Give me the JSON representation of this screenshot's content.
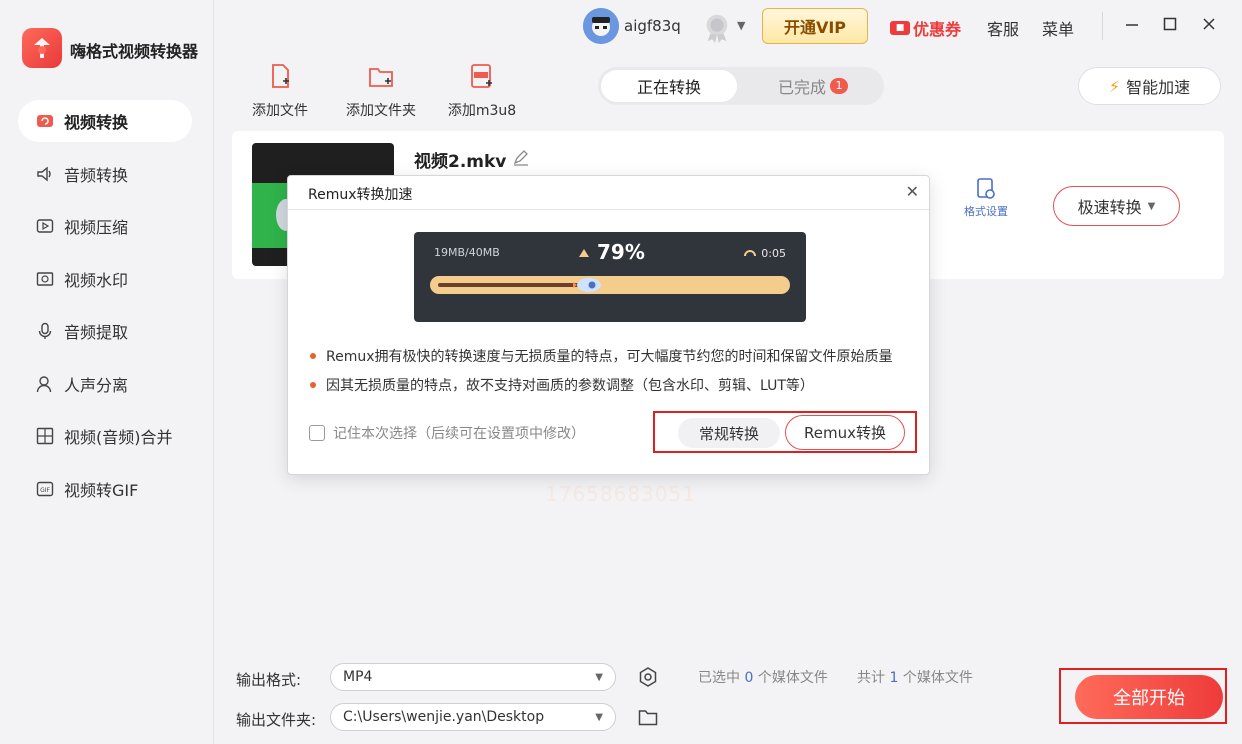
{
  "app": {
    "title": "嗨格式视频转换器"
  },
  "sidebar": {
    "items": [
      {
        "label": "视频转换",
        "icon": "video-convert-icon",
        "active": true
      },
      {
        "label": "音频转换",
        "icon": "audio-convert-icon"
      },
      {
        "label": "视频压缩",
        "icon": "video-compress-icon"
      },
      {
        "label": "视频水印",
        "icon": "video-watermark-icon"
      },
      {
        "label": "音频提取",
        "icon": "audio-extract-icon"
      },
      {
        "label": "人声分离",
        "icon": "voice-separate-icon"
      },
      {
        "label": "视频(音频)合并",
        "icon": "merge-icon"
      },
      {
        "label": "视频转GIF",
        "icon": "gif-icon"
      }
    ]
  },
  "topbar": {
    "username": "aigf83q",
    "vip_label": "开通VIP",
    "coupon_label": "优惠券",
    "service_label": "客服",
    "menu_label": "菜单"
  },
  "toolbar": {
    "add_file": "添加文件",
    "add_folder": "添加文件夹",
    "add_m3u8": "添加m3u8"
  },
  "tabs": {
    "converting": "正在转换",
    "done": "已完成",
    "done_count": "1"
  },
  "accel_label": "智能加速",
  "file": {
    "name": "视频2.mkv",
    "format_setting": "格式设置",
    "convert_mode": "极速转换"
  },
  "dialog": {
    "title": "Remux转换加速",
    "demo_size": "19MB/40MB",
    "demo_percent": "79%",
    "demo_progress": 0.42,
    "demo_time": "0:05",
    "bullets": [
      "Remux拥有极快的转换速度与无损质量的特点，可大幅度节约您的时间和保留文件原始质量",
      "因其无损质量的特点，故不支持对画质的参数调整（包含水印、剪辑、LUT等）"
    ],
    "remember_label": "记住本次选择（后续可在设置项中修改）",
    "normal_btn": "常规转换",
    "remux_btn": "Remux转换"
  },
  "watermark_text": "17658683051",
  "bottom": {
    "format_label": "输出格式:",
    "format_value": "MP4",
    "folder_label": "输出文件夹:",
    "folder_value": "C:\\Users\\wenjie.yan\\Desktop",
    "selected_prefix": "已选中",
    "selected_count": "0",
    "selected_suffix": "个媒体文件",
    "total_prefix": "共计",
    "total_count": "1",
    "total_suffix": "个媒体文件",
    "start_label": "全部开始"
  },
  "colors": {
    "accent": "#ee3b3b",
    "link": "#4a6fc4",
    "vip_border": "#e9b24a"
  }
}
